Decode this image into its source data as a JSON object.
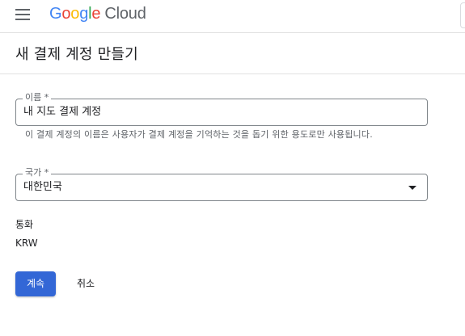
{
  "topbar": {
    "menu_icon": "hamburger-menu-icon",
    "logo": {
      "letters": [
        "G",
        "o",
        "o",
        "g",
        "l",
        "e"
      ],
      "product": "Cloud"
    }
  },
  "page": {
    "title": "새 결제 계정 만들기"
  },
  "form": {
    "name": {
      "label": "이름 *",
      "value": "내 지도 결제 계정",
      "helper": "이 결제 계정의 이름은 사용자가 결제 계정을 기억하는 것을 돕기 위한 용도로만 사용됩니다."
    },
    "country": {
      "label": "국가 *",
      "value": "대한민국",
      "icon": "dropdown-arrow-icon"
    },
    "currency": {
      "label": "통화",
      "value": "KRW"
    }
  },
  "actions": {
    "continue_label": "계속",
    "cancel_label": "취소"
  },
  "colors": {
    "primary": "#3367d6",
    "google_blue": "#4285f4",
    "google_red": "#ea4335",
    "google_yellow": "#fbbc04",
    "google_green": "#34a853",
    "border": "#80868b",
    "secondary_text": "#5f6368"
  }
}
